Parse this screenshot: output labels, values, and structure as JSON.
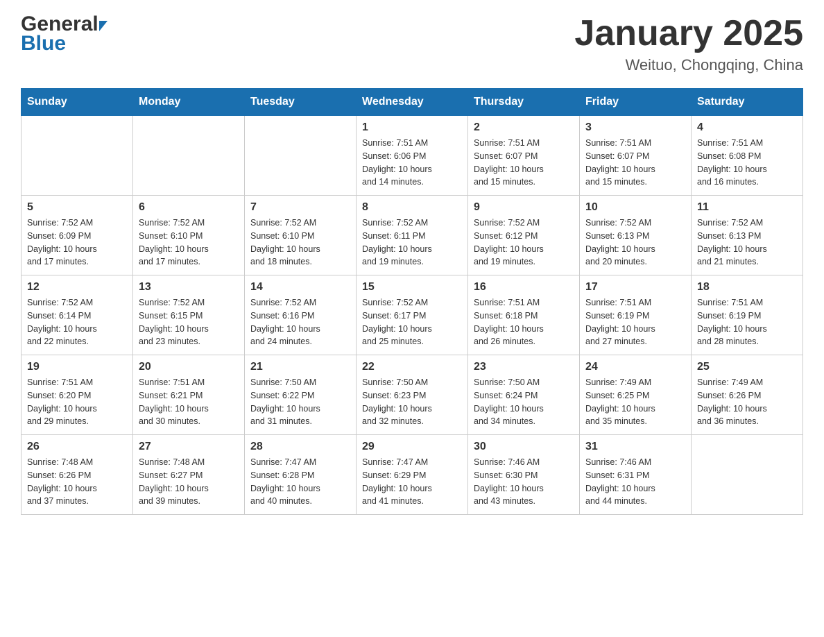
{
  "header": {
    "logo": {
      "general": "General",
      "blue": "Blue",
      "arrow": "▶"
    },
    "title": "January 2025",
    "subtitle": "Weituo, Chongqing, China"
  },
  "days_of_week": [
    "Sunday",
    "Monday",
    "Tuesday",
    "Wednesday",
    "Thursday",
    "Friday",
    "Saturday"
  ],
  "weeks": [
    [
      {
        "day": "",
        "info": ""
      },
      {
        "day": "",
        "info": ""
      },
      {
        "day": "",
        "info": ""
      },
      {
        "day": "1",
        "info": "Sunrise: 7:51 AM\nSunset: 6:06 PM\nDaylight: 10 hours\nand 14 minutes."
      },
      {
        "day": "2",
        "info": "Sunrise: 7:51 AM\nSunset: 6:07 PM\nDaylight: 10 hours\nand 15 minutes."
      },
      {
        "day": "3",
        "info": "Sunrise: 7:51 AM\nSunset: 6:07 PM\nDaylight: 10 hours\nand 15 minutes."
      },
      {
        "day": "4",
        "info": "Sunrise: 7:51 AM\nSunset: 6:08 PM\nDaylight: 10 hours\nand 16 minutes."
      }
    ],
    [
      {
        "day": "5",
        "info": "Sunrise: 7:52 AM\nSunset: 6:09 PM\nDaylight: 10 hours\nand 17 minutes."
      },
      {
        "day": "6",
        "info": "Sunrise: 7:52 AM\nSunset: 6:10 PM\nDaylight: 10 hours\nand 17 minutes."
      },
      {
        "day": "7",
        "info": "Sunrise: 7:52 AM\nSunset: 6:10 PM\nDaylight: 10 hours\nand 18 minutes."
      },
      {
        "day": "8",
        "info": "Sunrise: 7:52 AM\nSunset: 6:11 PM\nDaylight: 10 hours\nand 19 minutes."
      },
      {
        "day": "9",
        "info": "Sunrise: 7:52 AM\nSunset: 6:12 PM\nDaylight: 10 hours\nand 19 minutes."
      },
      {
        "day": "10",
        "info": "Sunrise: 7:52 AM\nSunset: 6:13 PM\nDaylight: 10 hours\nand 20 minutes."
      },
      {
        "day": "11",
        "info": "Sunrise: 7:52 AM\nSunset: 6:13 PM\nDaylight: 10 hours\nand 21 minutes."
      }
    ],
    [
      {
        "day": "12",
        "info": "Sunrise: 7:52 AM\nSunset: 6:14 PM\nDaylight: 10 hours\nand 22 minutes."
      },
      {
        "day": "13",
        "info": "Sunrise: 7:52 AM\nSunset: 6:15 PM\nDaylight: 10 hours\nand 23 minutes."
      },
      {
        "day": "14",
        "info": "Sunrise: 7:52 AM\nSunset: 6:16 PM\nDaylight: 10 hours\nand 24 minutes."
      },
      {
        "day": "15",
        "info": "Sunrise: 7:52 AM\nSunset: 6:17 PM\nDaylight: 10 hours\nand 25 minutes."
      },
      {
        "day": "16",
        "info": "Sunrise: 7:51 AM\nSunset: 6:18 PM\nDaylight: 10 hours\nand 26 minutes."
      },
      {
        "day": "17",
        "info": "Sunrise: 7:51 AM\nSunset: 6:19 PM\nDaylight: 10 hours\nand 27 minutes."
      },
      {
        "day": "18",
        "info": "Sunrise: 7:51 AM\nSunset: 6:19 PM\nDaylight: 10 hours\nand 28 minutes."
      }
    ],
    [
      {
        "day": "19",
        "info": "Sunrise: 7:51 AM\nSunset: 6:20 PM\nDaylight: 10 hours\nand 29 minutes."
      },
      {
        "day": "20",
        "info": "Sunrise: 7:51 AM\nSunset: 6:21 PM\nDaylight: 10 hours\nand 30 minutes."
      },
      {
        "day": "21",
        "info": "Sunrise: 7:50 AM\nSunset: 6:22 PM\nDaylight: 10 hours\nand 31 minutes."
      },
      {
        "day": "22",
        "info": "Sunrise: 7:50 AM\nSunset: 6:23 PM\nDaylight: 10 hours\nand 32 minutes."
      },
      {
        "day": "23",
        "info": "Sunrise: 7:50 AM\nSunset: 6:24 PM\nDaylight: 10 hours\nand 34 minutes."
      },
      {
        "day": "24",
        "info": "Sunrise: 7:49 AM\nSunset: 6:25 PM\nDaylight: 10 hours\nand 35 minutes."
      },
      {
        "day": "25",
        "info": "Sunrise: 7:49 AM\nSunset: 6:26 PM\nDaylight: 10 hours\nand 36 minutes."
      }
    ],
    [
      {
        "day": "26",
        "info": "Sunrise: 7:48 AM\nSunset: 6:26 PM\nDaylight: 10 hours\nand 37 minutes."
      },
      {
        "day": "27",
        "info": "Sunrise: 7:48 AM\nSunset: 6:27 PM\nDaylight: 10 hours\nand 39 minutes."
      },
      {
        "day": "28",
        "info": "Sunrise: 7:47 AM\nSunset: 6:28 PM\nDaylight: 10 hours\nand 40 minutes."
      },
      {
        "day": "29",
        "info": "Sunrise: 7:47 AM\nSunset: 6:29 PM\nDaylight: 10 hours\nand 41 minutes."
      },
      {
        "day": "30",
        "info": "Sunrise: 7:46 AM\nSunset: 6:30 PM\nDaylight: 10 hours\nand 43 minutes."
      },
      {
        "day": "31",
        "info": "Sunrise: 7:46 AM\nSunset: 6:31 PM\nDaylight: 10 hours\nand 44 minutes."
      },
      {
        "day": "",
        "info": ""
      }
    ]
  ]
}
